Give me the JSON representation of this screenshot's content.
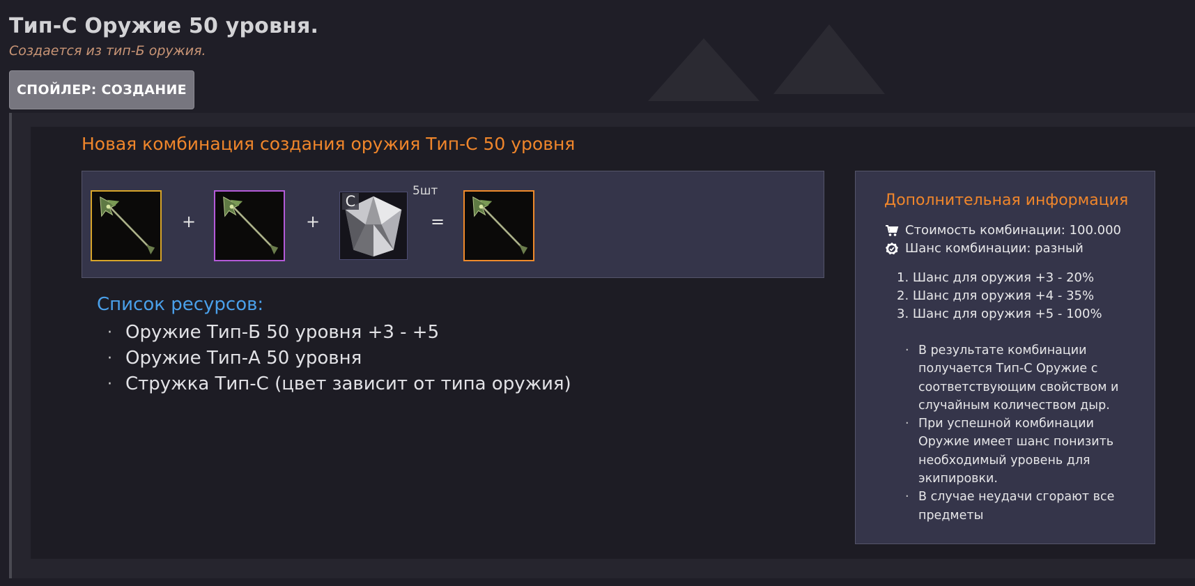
{
  "page": {
    "title": "Тип-С Оружие 50 уровня.",
    "subtitle": "Создается из тип-Б оружия."
  },
  "spoiler": {
    "label": "СПОЙЛЕР: СОЗДАНИЕ"
  },
  "combination": {
    "title": "Новая комбинация создания оружия Тип-С 50 уровня",
    "operators": [
      "+",
      "+",
      "="
    ],
    "items": [
      {
        "icon": "spear-weapon-icon",
        "frame_color": "#d8a529"
      },
      {
        "icon": "spear-weapon-icon",
        "frame_color": "#b45ad8"
      },
      {
        "icon": "crystal-shard-icon",
        "grade": "C",
        "quantity": "5шт"
      },
      {
        "icon": "spear-weapon-icon",
        "frame_color": "#ef8a2b"
      }
    ]
  },
  "resources": {
    "title": "Список ресурсов:",
    "items": [
      "Оружие Тип-Б 50 уровня +3 - +5",
      "Оружие Тип-А 50 уровня",
      "Стружка Тип-С (цвет зависит от типа оружия)"
    ]
  },
  "info": {
    "title": "Дополнительная информация",
    "cost": {
      "icon": "cart-icon",
      "text": "Стоимость комбинации: 100.000"
    },
    "chance": {
      "icon": "badge-check-icon",
      "text": "Шанс комбинации: разный"
    },
    "chances": [
      "1. Шанс для оружия +3 - 20%",
      "2. Шанс для оружия +4 - 35%",
      "3. Шанс для оружия +5 - 100%"
    ],
    "notes": [
      "В результате комбинации получается Тип-С Оружие с соответствующим свойством и случайным количеством дыр.",
      "При успешной комбинации Оружие имеет шанс понизить необходимый уровень для экипировки.",
      "В случае неудачи сгорают все предметы"
    ]
  },
  "colors": {
    "accent_orange": "#f0862b",
    "accent_blue": "#4aa0ea",
    "subtitle": "#c99576",
    "background": "#1f1e27"
  }
}
